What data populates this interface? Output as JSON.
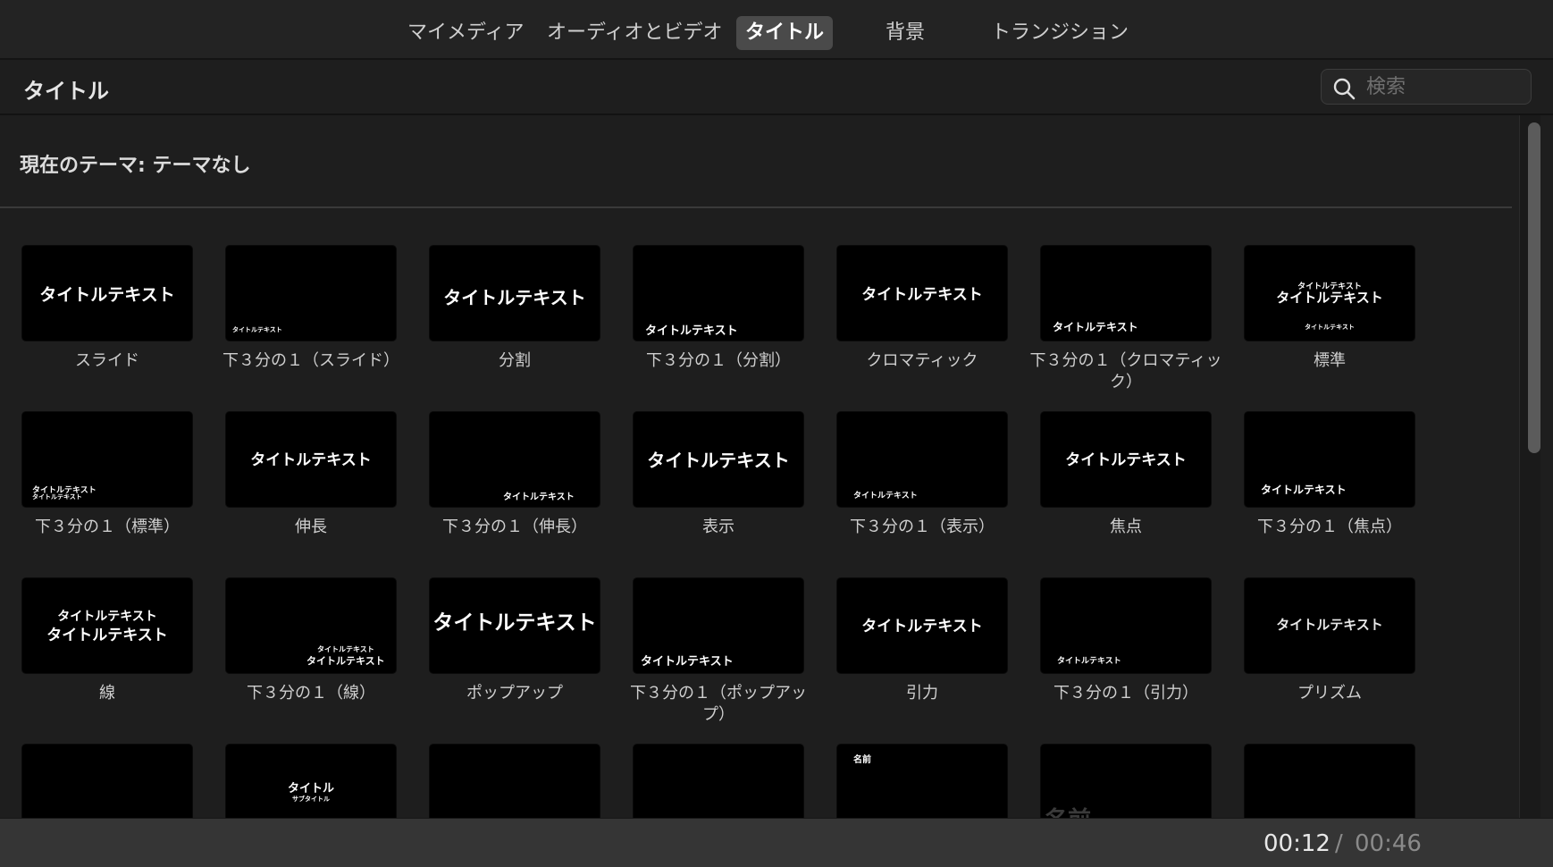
{
  "tabs": {
    "my_media": "マイメディア",
    "audio_video": "オーディオとビデオ",
    "titles": "タイトル",
    "backgrounds": "背景",
    "transitions": "トランジション"
  },
  "section_title": "タイトル",
  "search": {
    "placeholder": "検索",
    "value": ""
  },
  "theme_label": "現在のテーマ: テーマなし",
  "tiles": [
    {
      "label": "スライド",
      "thumb": [
        "タイトルテキスト"
      ]
    },
    {
      "label": "下３分の１（スライド）",
      "thumb": [
        "タイトルテキスト"
      ]
    },
    {
      "label": "分割",
      "thumb": [
        "タイトルテキスト"
      ]
    },
    {
      "label": "下３分の１（分割）",
      "thumb": [
        "タイトルテキスト"
      ]
    },
    {
      "label": "クロマティック",
      "thumb": [
        "タイトルテキスト"
      ]
    },
    {
      "label": "下３分の１（クロマティック）",
      "thumb": [
        "タイトルテキスト"
      ]
    },
    {
      "label": "標準",
      "thumb": [
        "タイトルテキスト",
        "タイトルテキスト",
        "タイトルテキスト"
      ]
    },
    {
      "label": "下３分の１（標準）",
      "thumb": [
        "タイトルテキスト",
        "タイトルテキスト"
      ]
    },
    {
      "label": "伸長",
      "thumb": [
        "タイトルテキスト"
      ]
    },
    {
      "label": "下３分の１（伸長）",
      "thumb": [
        "タイトルテキスト"
      ]
    },
    {
      "label": "表示",
      "thumb": [
        "タイトルテキスト"
      ]
    },
    {
      "label": "下３分の１（表示）",
      "thumb": [
        "タイトルテキスト"
      ]
    },
    {
      "label": "焦点",
      "thumb": [
        "タイトルテキスト"
      ]
    },
    {
      "label": "下３分の１（焦点）",
      "thumb": [
        "タイトルテキスト"
      ]
    },
    {
      "label": "線",
      "thumb": [
        "タイトルテキスト",
        "タイトルテキスト"
      ]
    },
    {
      "label": "下３分の１（線）",
      "thumb": [
        "タイトルテキスト",
        "タイトルテキスト"
      ]
    },
    {
      "label": "ポップアップ",
      "thumb": [
        "タイトルテキスト"
      ]
    },
    {
      "label": "下３分の１（ポップアップ）",
      "thumb": [
        "タイトルテキスト"
      ]
    },
    {
      "label": "引力",
      "thumb": [
        "タイトルテキスト"
      ]
    },
    {
      "label": "下３分の１（引力）",
      "thumb": [
        "タイトルテキスト"
      ]
    },
    {
      "label": "プリズム",
      "thumb": [
        "タイトルテキスト"
      ]
    },
    {
      "label": "",
      "thumb": []
    },
    {
      "label": "",
      "thumb": [
        "タイトル",
        "サブタイトル"
      ]
    },
    {
      "label": "",
      "thumb": []
    },
    {
      "label": "",
      "thumb": []
    },
    {
      "label": "",
      "thumb": [
        "名前"
      ]
    },
    {
      "label": "",
      "thumb": [
        "名前"
      ]
    },
    {
      "label": "",
      "thumb": []
    }
  ],
  "time": {
    "current": "00:12",
    "separator": "/",
    "total": "00:46"
  },
  "colors": {
    "background": "#1e1e1e",
    "active_tab": "#4a4a4a",
    "thumbnail": "#000000",
    "footer": "#353535"
  }
}
